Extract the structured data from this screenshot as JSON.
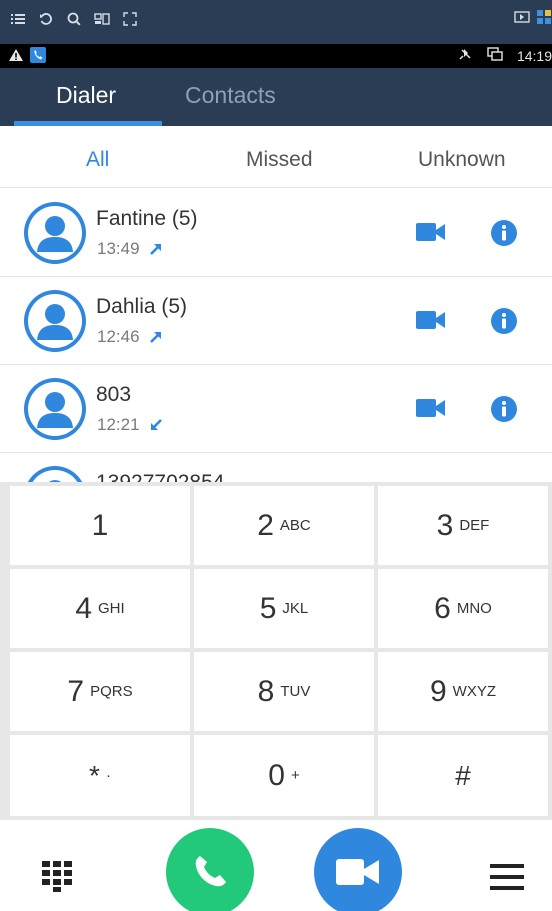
{
  "status_bar": {
    "time": "14:19"
  },
  "tabs": [
    {
      "label": "Dialer",
      "active": true
    },
    {
      "label": "Contacts",
      "active": false
    }
  ],
  "filters": [
    {
      "label": "All",
      "active": true
    },
    {
      "label": "Missed",
      "active": false
    },
    {
      "label": "Unknown",
      "active": false
    }
  ],
  "calls": [
    {
      "name": "Fantine (5)",
      "time": "13:49",
      "direction": "outgoing"
    },
    {
      "name": "Dahlia (5)",
      "time": "12:46",
      "direction": "outgoing"
    },
    {
      "name": "803",
      "time": "12:21",
      "direction": "incoming"
    },
    {
      "name": "13927702854",
      "time": "",
      "direction": ""
    }
  ],
  "keypad": {
    "k1": {
      "digit": "1",
      "letters": ""
    },
    "k2": {
      "digit": "2",
      "letters": "ABC"
    },
    "k3": {
      "digit": "3",
      "letters": "DEF"
    },
    "k4": {
      "digit": "4",
      "letters": "GHI"
    },
    "k5": {
      "digit": "5",
      "letters": "JKL"
    },
    "k6": {
      "digit": "6",
      "letters": "MNO"
    },
    "k7": {
      "digit": "7",
      "letters": "PQRS"
    },
    "k8": {
      "digit": "8",
      "letters": "TUV"
    },
    "k9": {
      "digit": "9",
      "letters": "WXYZ"
    },
    "kstar": {
      "digit": "*",
      "letters": "·"
    },
    "k0": {
      "digit": "0",
      "letters": "+"
    },
    "khash": {
      "digit": "#",
      "letters": ""
    }
  },
  "colors": {
    "header_bg": "#2b3d55",
    "accent_blue": "#2f88de",
    "call_green": "#23c97a"
  },
  "icons": {
    "call": "phone-icon",
    "video": "video-camera-icon",
    "info": "info-icon",
    "dialpad": "dialpad-icon",
    "menu": "menu-icon"
  }
}
